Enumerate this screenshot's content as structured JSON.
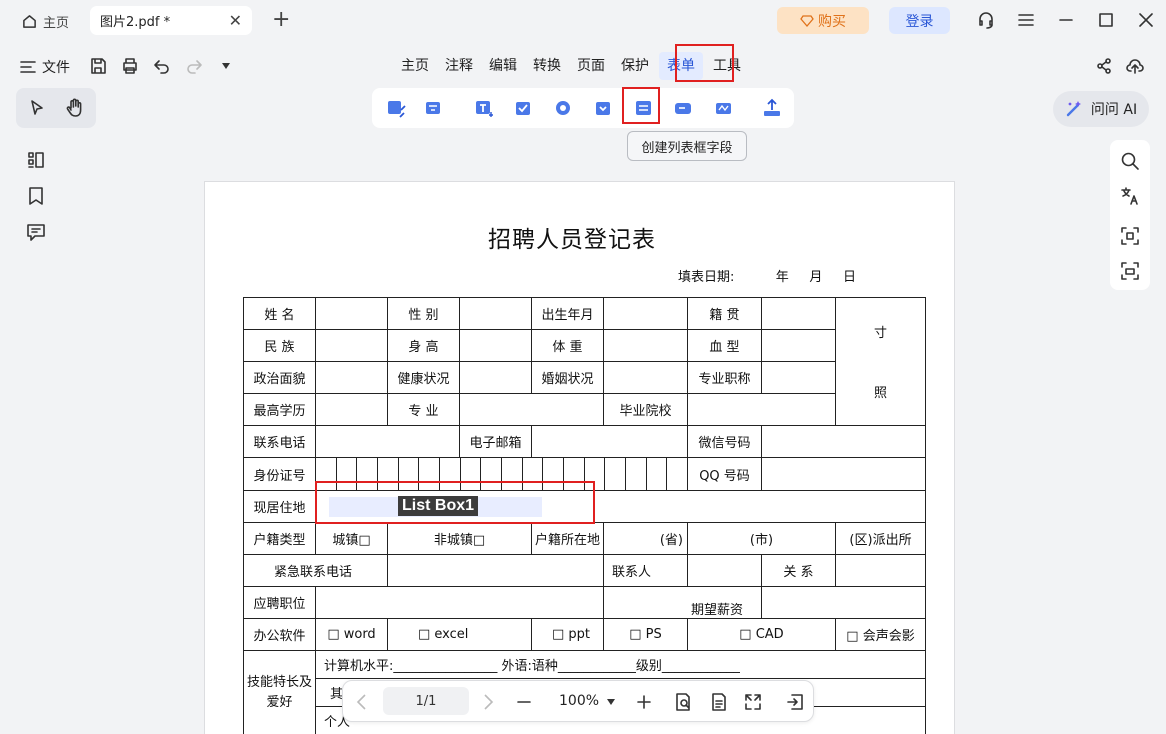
{
  "tabs": {
    "home_label": "主页",
    "file_label": "图片2.pdf *"
  },
  "header": {
    "buy_label": "购买",
    "login_label": "登录"
  },
  "file_menu_label": "文件",
  "menu": [
    "主页",
    "注释",
    "编辑",
    "转换",
    "页面",
    "保护",
    "表单",
    "工具"
  ],
  "active_menu": "表单",
  "tooltip": "创建列表框字段",
  "ask_ai_label": "问问 AI",
  "accent_color": "#2a57d6",
  "highlight_color": "#e02020",
  "document": {
    "title": "招聘人员登记表",
    "fill_date": "填表日期:          年     月     日",
    "rows": {
      "r1": [
        "姓 名",
        "性 别",
        "出生年月",
        "籍 贯",
        "寸"
      ],
      "r2": [
        "民 族",
        "身 高",
        "体 重",
        "血 型"
      ],
      "r3": [
        "政治面貌",
        "健康状况",
        "婚姻状况",
        "专业职称",
        "照"
      ],
      "r4": [
        "最高学历",
        "专 业",
        "毕业院校"
      ],
      "r5": [
        "联系电话",
        "电子邮箱",
        "微信号码"
      ],
      "r6": [
        "身份证号",
        "QQ 号码"
      ],
      "r7": [
        "现居住地"
      ],
      "r8": [
        "户籍类型",
        "城镇□",
        "非城镇□",
        "户籍所在地",
        "(省)",
        "(市)",
        "(区)派出所"
      ],
      "r9": [
        "紧急联系电话",
        "联系人",
        "关 系"
      ],
      "r10": [
        "应聘职位",
        "期望薪资"
      ],
      "r11": [
        "办公软件",
        "□ word",
        "□ excel",
        "□ ppt",
        "□ PS",
        "□ CAD",
        "□ 会声会影"
      ],
      "r12": [
        "技能特长及爱好",
        "计算机水平:________________     外语:语种____________级别____________",
        "其它技能:",
        "个人"
      ]
    },
    "list_box_label": "List Box1"
  },
  "nav": {
    "page": "1/1",
    "zoom": "100%"
  }
}
